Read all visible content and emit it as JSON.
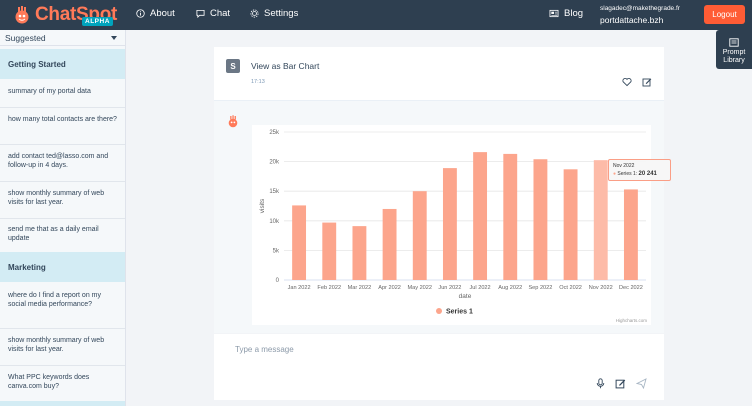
{
  "header": {
    "logo_text": "ChatSpot",
    "logo_badge": "ALPHA",
    "nav": [
      {
        "label": "About",
        "icon": "info-icon"
      },
      {
        "label": "Chat",
        "icon": "chat-icon"
      },
      {
        "label": "Settings",
        "icon": "gear-icon"
      }
    ],
    "blog_label": "Blog",
    "account_email": "slagadec@makethegrade.fr",
    "account_portal": "portdattache.bzh",
    "logout_label": "Logout"
  },
  "sidebar": {
    "selected": "Suggested",
    "sections": [
      {
        "title": "Getting Started",
        "items": [
          "summary of my portal data",
          "how many total contacts are there?",
          "add contact ted@lasso.com and follow-up in 4 days.",
          "show monthly summary of web visits for last year.",
          "send me that as a daily email update"
        ]
      },
      {
        "title": "Marketing",
        "items": [
          "where do I find a report on my social media performance?",
          "show monthly summary of web visits for last year.",
          "What PPC keywords does canva.com buy?"
        ]
      }
    ]
  },
  "prompt_library": {
    "line1": "Prompt",
    "line2": "Library"
  },
  "message": {
    "avatar_initial": "S",
    "text": "View as Bar Chart",
    "time": "17:13"
  },
  "composer": {
    "placeholder": "Type a message"
  },
  "tooltip": {
    "title": "Nov 2022",
    "series_label": "Series 1:",
    "value_text": "20 241"
  },
  "colors": {
    "bar": "#fca58c",
    "bar_hover": "#fdbba8",
    "accent": "#ff5c35",
    "nav_bg": "#2e3f50"
  },
  "chart_data": {
    "type": "bar",
    "categories": [
      "Jan 2022",
      "Feb 2022",
      "Mar 2022",
      "Apr 2022",
      "May 2022",
      "Jun 2022",
      "Jul 2022",
      "Aug 2022",
      "Sep 2022",
      "Oct 2022",
      "Nov 2022",
      "Dec 2022"
    ],
    "series": [
      {
        "name": "Series 1",
        "values": [
          12600,
          9700,
          9100,
          12000,
          15000,
          18900,
          21600,
          21300,
          20400,
          18700,
          20241,
          15300
        ]
      }
    ],
    "yticks": [
      "0",
      "5k",
      "10k",
      "15k",
      "20k",
      "25k"
    ],
    "ylim": [
      0,
      25000
    ],
    "xlabel": "date",
    "ylabel": "visits",
    "credit": "Highcharts.com",
    "highlight_index": 10,
    "legend": "bottom-center",
    "grid": true
  }
}
